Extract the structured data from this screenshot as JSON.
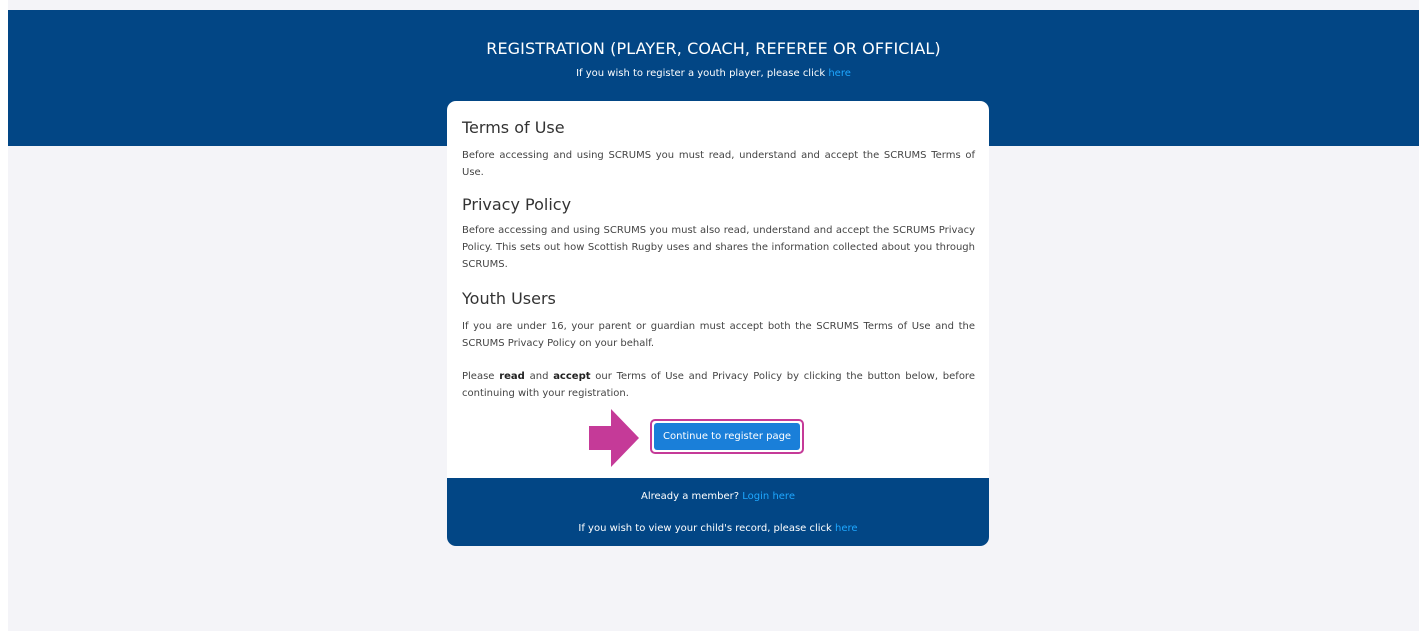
{
  "banner": {
    "title": "REGISTRATION (PLAYER, COACH, REFEREE OR OFFICIAL)",
    "youth_text": "If you wish to register a youth player, please click ",
    "youth_link": "here"
  },
  "terms": {
    "heading": "Terms of Use",
    "text": "Before accessing and using SCRUMS you must read, understand and accept the SCRUMS Terms of Use."
  },
  "privacy": {
    "heading": "Privacy Policy",
    "text": "Before accessing and using SCRUMS you must also read, understand and accept the SCRUMS Privacy Policy. This sets out how Scottish Rugby uses and shares the information collected about you through SCRUMS."
  },
  "youth": {
    "heading": "Youth Users",
    "text": "If you are under 16, your parent or guardian must accept both the SCRUMS Terms of Use and the SCRUMS Privacy Policy on your behalf."
  },
  "instruction": {
    "prefix": "Please ",
    "read": "read",
    "and": " and ",
    "accept": "accept",
    "suffix": " our Terms of Use and Privacy Policy by clicking the button below, before continuing with your registration."
  },
  "cta": {
    "label": "Continue to register page"
  },
  "footer": {
    "member_text": "Already a member? ",
    "login_link": "Login here",
    "child_text": "If you wish to view your child's record, please click ",
    "child_link": "here"
  },
  "colors": {
    "navy": "#024685",
    "link": "#1ea7ff",
    "button": "#1a7fd9",
    "highlight": "#c53a98",
    "page_bg": "#f4f4f8"
  }
}
